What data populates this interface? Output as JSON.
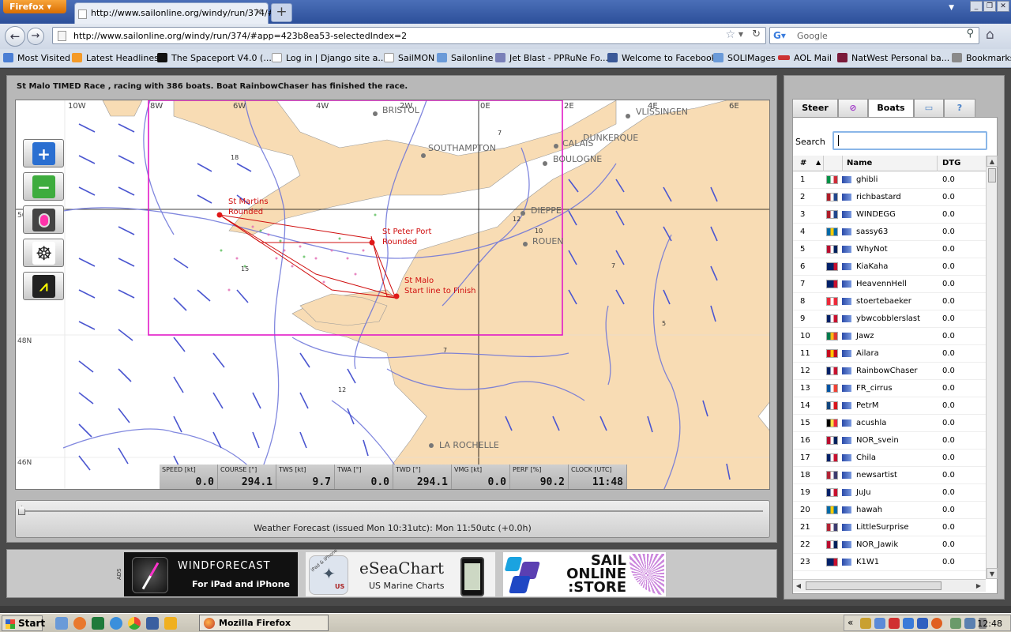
{
  "browser": {
    "app_button": "Firefox",
    "tab_title": "http://www.sailonline.org/windy/run/374/#",
    "url": "http://www.sailonline.org/windy/run/374/#app=423b8ea53-selectedIndex=2",
    "search_placeholder": "Google",
    "bookmarks": [
      "Most Visited",
      "Latest Headlines",
      "The Spaceport V4.0 (...",
      "Log in | Django site a...",
      "SailMON",
      "Sailonline",
      "Jet Blast - PPRuNe Fo...",
      "Welcome to Facebook",
      "SOLIMages",
      "AOL Mail",
      "NatWest Personal ba...",
      "Bookmarks"
    ]
  },
  "race": {
    "status": "St Malo TIMED Race , racing with 386 boats. Boat RainbowChaser has finished the race."
  },
  "map": {
    "lon_labels": [
      "10W",
      "8W",
      "6W",
      "4W",
      "2W",
      "0E",
      "2E",
      "4E",
      "6E"
    ],
    "lat_labels": [
      "50N",
      "48N",
      "46N"
    ],
    "places": [
      "BRISTOL",
      "SOUTHAMPTON",
      "CALAIS",
      "DUNKERQUE",
      "VLISSINGEN",
      "BOULOGNE",
      "DIEPPE",
      "ROUEN",
      "LA ROCHELLE"
    ],
    "marks": [
      "St Martins",
      "Rounded",
      "St Peter Port",
      "Rounded",
      "St Malo",
      "Start line to Finish"
    ],
    "isobar_values": [
      "18",
      "15",
      "12",
      "10",
      "7",
      "7",
      "5",
      "7",
      "12"
    ]
  },
  "instruments": [
    {
      "key": "SPEED [kt]",
      "value": "0.0"
    },
    {
      "key": "COURSE [°]",
      "value": "294.1"
    },
    {
      "key": "TWS [kt]",
      "value": "9.7"
    },
    {
      "key": "TWA [°]",
      "value": "0.0"
    },
    {
      "key": "TWD [°]",
      "value": "294.1"
    },
    {
      "key": "VMG [kt]",
      "value": "0.0"
    },
    {
      "key": "PERF [%]",
      "value": "90.2"
    },
    {
      "key": "CLOCK [UTC]",
      "value": "11:48"
    }
  ],
  "timeline": {
    "forecast": "Weather Forecast  (issued Mon 10:31utc): Mon 11:50utc  (+0.0h)",
    "position": 0.0
  },
  "ads": {
    "label": "ADS",
    "windforecast_title": "WINDFORECAST",
    "windforecast_sub": "For iPad and iPhone",
    "eseachart_badge": "iPad & iPhone",
    "eseachart_title": "eSeaChart",
    "eseachart_sub": "US Marine Charts",
    "eseachart_us": "US",
    "store_line1": "SAIL",
    "store_line2": "ONLINE",
    "store_line3": ":STORE"
  },
  "side": {
    "tabs": [
      "Steer",
      "",
      "Boats",
      "",
      ""
    ],
    "tab_icons": [
      "",
      "compass-icon",
      "",
      "chat-icon",
      "help-icon"
    ],
    "search_label": "Search",
    "columns": {
      "num": "#",
      "sort": "▲",
      "name": "Name",
      "dtg": "DTG"
    },
    "boats": [
      {
        "n": "1",
        "name": "ghibli",
        "dtg": "0.0",
        "flag": [
          "#009246",
          "#fff",
          "#ce2b37"
        ]
      },
      {
        "n": "2",
        "name": "richbastard",
        "dtg": "0.0",
        "flag": [
          "#ae1c28",
          "#fff",
          "#21468b"
        ]
      },
      {
        "n": "3",
        "name": "WINDEGG",
        "dtg": "0.0",
        "flag": [
          "#ae1c28",
          "#fff",
          "#21468b"
        ]
      },
      {
        "n": "4",
        "name": "sassy63",
        "dtg": "0.0",
        "flag": [
          "#006aa7",
          "#fecc00",
          "#006aa7"
        ]
      },
      {
        "n": "5",
        "name": "WhyNot",
        "dtg": "0.0",
        "flag": [
          "#ba0c2f",
          "#fff",
          "#00205b"
        ]
      },
      {
        "n": "6",
        "name": "KiaKaha",
        "dtg": "0.0",
        "flag": [
          "#012169",
          "#012169",
          "#c8102e"
        ]
      },
      {
        "n": "7",
        "name": "HeavennHell",
        "dtg": "0.0",
        "flag": [
          "#012169",
          "#012169",
          "#c8102e"
        ]
      },
      {
        "n": "8",
        "name": "stoertebaeker",
        "dtg": "0.0",
        "flag": [
          "#ed2939",
          "#fff",
          "#ed2939"
        ]
      },
      {
        "n": "9",
        "name": "ybwcobblerslast",
        "dtg": "0.0",
        "flag": [
          "#012169",
          "#fff",
          "#c8102e"
        ]
      },
      {
        "n": "10",
        "name": "Jawz",
        "dtg": "0.0",
        "flag": [
          "#007a4d",
          "#ffb612",
          "#de3831"
        ]
      },
      {
        "n": "11",
        "name": "Ailara",
        "dtg": "0.0",
        "flag": [
          "#c60b1e",
          "#ffc400",
          "#c60b1e"
        ]
      },
      {
        "n": "12",
        "name": "RainbowChaser",
        "dtg": "0.0",
        "flag": [
          "#012169",
          "#fff",
          "#c8102e"
        ]
      },
      {
        "n": "13",
        "name": "FR_cirrus",
        "dtg": "0.0",
        "flag": [
          "#0055a4",
          "#fff",
          "#ef4135"
        ]
      },
      {
        "n": "14",
        "name": "PetrM",
        "dtg": "0.0",
        "flag": [
          "#11457e",
          "#fff",
          "#d7141a"
        ]
      },
      {
        "n": "15",
        "name": "acushla",
        "dtg": "0.0",
        "flag": [
          "#000",
          "#fae042",
          "#ed2939"
        ]
      },
      {
        "n": "16",
        "name": "NOR_svein",
        "dtg": "0.0",
        "flag": [
          "#ba0c2f",
          "#fff",
          "#00205b"
        ]
      },
      {
        "n": "17",
        "name": "Chila",
        "dtg": "0.0",
        "flag": [
          "#012169",
          "#fff",
          "#c8102e"
        ]
      },
      {
        "n": "18",
        "name": "newsartist",
        "dtg": "0.0",
        "flag": [
          "#b22234",
          "#fff",
          "#3c3b6e"
        ]
      },
      {
        "n": "19",
        "name": "JuJu",
        "dtg": "0.0",
        "flag": [
          "#012169",
          "#fff",
          "#c8102e"
        ]
      },
      {
        "n": "20",
        "name": "hawah",
        "dtg": "0.0",
        "flag": [
          "#006aa7",
          "#fecc00",
          "#006aa7"
        ]
      },
      {
        "n": "21",
        "name": "LittleSurprise",
        "dtg": "0.0",
        "flag": [
          "#b22234",
          "#fff",
          "#3c3b6e"
        ]
      },
      {
        "n": "22",
        "name": "NOR_Jawik",
        "dtg": "0.0",
        "flag": [
          "#ba0c2f",
          "#fff",
          "#00205b"
        ]
      },
      {
        "n": "23",
        "name": "K1W1",
        "dtg": "0.0",
        "flag": [
          "#012169",
          "#012169",
          "#c8102e"
        ]
      }
    ]
  },
  "taskbar": {
    "start": "Start",
    "window": "Mozilla Firefox",
    "clock": "12:48",
    "tray_chevron": "«"
  }
}
